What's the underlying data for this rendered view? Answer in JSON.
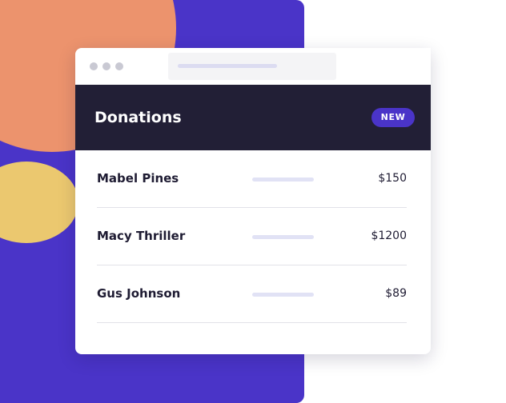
{
  "colors": {
    "accent": "#4a34c8",
    "orange": "#ec936d",
    "yellow": "#ebc86f",
    "header_bg": "#221f36"
  },
  "header": {
    "title": "Donations",
    "badge": "NEW"
  },
  "donations": [
    {
      "name": "Mabel Pines",
      "amount": "$150"
    },
    {
      "name": "Macy Thriller",
      "amount": "$1200"
    },
    {
      "name": "Gus Johnson",
      "amount": "$89"
    }
  ]
}
